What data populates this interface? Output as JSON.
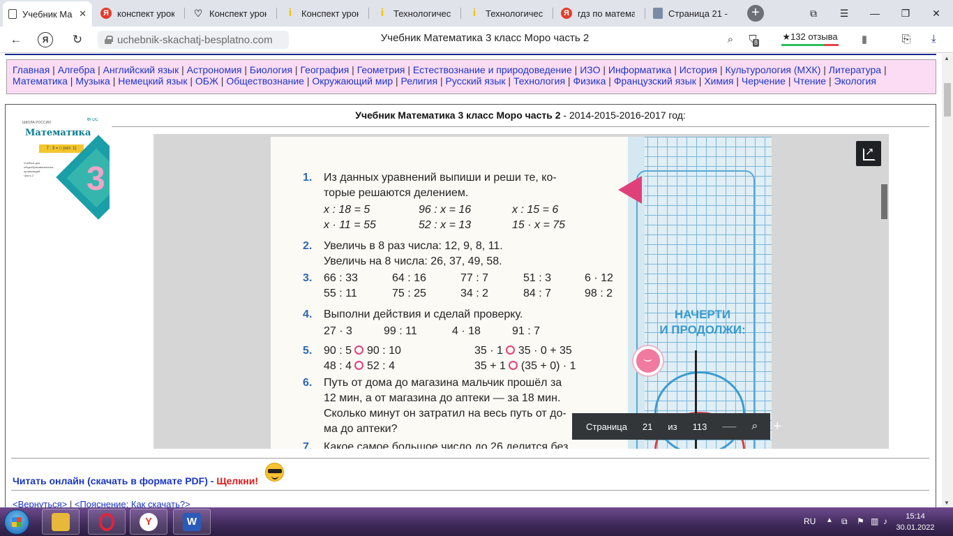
{
  "browser": {
    "tabs": [
      {
        "title": "Учебник Ма",
        "icon": "page-icon",
        "active": true
      },
      {
        "title": "конспект урок",
        "icon": "yandex-icon"
      },
      {
        "title": "Конспект урок",
        "icon": "heart-icon"
      },
      {
        "title": "Конспект урок",
        "icon": "yellow-i-icon"
      },
      {
        "title": "Технологическ",
        "icon": "yellow-i-icon"
      },
      {
        "title": "Технологическ",
        "icon": "yellow-i-icon"
      },
      {
        "title": "гдз по математ",
        "icon": "yandex-icon"
      },
      {
        "title": "Страница 21 -",
        "icon": "doc-icon"
      }
    ],
    "url": "uchebnik-skachatj-besplatno.com",
    "page_title": "Учебник Математика 3 класс Моро часть 2",
    "reviews": "★132 отзыва",
    "tab_badge": "8"
  },
  "nav": {
    "subjects": [
      "Главная",
      "Алгебра",
      "Английский язык",
      "Астрономия",
      "Биология",
      "География",
      "Геометрия",
      "Естествознание и природоведение",
      "ИЗО",
      "Информатика",
      "История",
      "Культурология (МХК)",
      "Литература",
      "Математика",
      "Музыка",
      "Немецкий язык",
      "ОБЖ",
      "Обществознание",
      "Окружающий мир",
      "Религия",
      "Русский язык",
      "Технология",
      "Физика",
      "Французский язык",
      "Химия",
      "Черчение",
      "Чтение",
      "Экология"
    ]
  },
  "book": {
    "heading_bold": "Учебник Математика 3 класс Моро часть 2",
    "heading_rest": " - 2014-2015-2016-2017 год:",
    "cover": {
      "top": "ШКОЛА РОССИИ",
      "title": "Математика",
      "number": "3",
      "fgos": "ФГОС",
      "band": "7 : 3 = □ (ост. 1)",
      "subtitle": "Учебник для общеобразовательных организаций",
      "part": "Часть 2"
    }
  },
  "textbook_page": {
    "ex1_num": "1.",
    "ex1_text1": "Из данных уравнений выпиши и реши те, ко-",
    "ex1_text2": "торые решаются делением.",
    "ex1_eq": [
      "x : 18 = 5",
      "96 : x = 16",
      "x : 15 = 6",
      "x · 11 = 55",
      "52 : x = 13",
      "15 · x = 75"
    ],
    "ex2_num": "2.",
    "ex2_line1": "Увеличь в 8 раз числа: 12, 9, 8, 11.",
    "ex2_line2": "Увеличь на 8 числа: 26, 37, 49, 58.",
    "ex3_num": "3.",
    "ex3_row1": [
      "66 : 33",
      "64 : 16",
      "77 : 7",
      "51 : 3",
      "6 · 12"
    ],
    "ex3_row2": [
      "55 : 11",
      "75 : 25",
      "34 : 2",
      "84 : 7",
      "98 : 2"
    ],
    "ex4_num": "4.",
    "ex4_text": "Выполни действия и сделай проверку.",
    "ex4_row": [
      "27 · 3",
      "99 : 11",
      "4 · 18",
      "91 : 7"
    ],
    "ex5_num": "5.",
    "ex5_row1": [
      "90 : 5",
      "90 : 10",
      "35 · 1",
      "35 · 0 + 35"
    ],
    "ex5_row2": [
      "48 : 4",
      "52 : 4",
      "35 + 1",
      "(35 + 0) · 1"
    ],
    "ex6_num": "6.",
    "ex6_l1": "Путь от дома до магазина мальчик прошёл за",
    "ex6_l2": "12 мин, а от магазина до аптеки — за 18 мин.",
    "ex6_l3": "Сколько минут он затратил на весь путь от до-",
    "ex6_l4": "ма до аптеки?",
    "ex7_num": "7.",
    "ex7_l1": "Какое самое большое число до 26 делится без",
    "margin_line1": "НАЧЕРТИ",
    "margin_line2": "И ПРОДОЛЖИ:"
  },
  "viewer": {
    "page_label": "Страница",
    "page_current": "21",
    "page_of": "из",
    "page_total": "113"
  },
  "footer": {
    "read_online": "Читать онлайн (скачать в формате PDF) - ",
    "click": "Щелкни!",
    "back": "<Вернуться>",
    "sep": " | ",
    "explain": "<Пояснение: Как скачать?>"
  },
  "taskbar": {
    "lang": "RU",
    "time": "15:14",
    "date": "30.01.2022",
    "apps": [
      "explorer-icon",
      "opera-icon",
      "yandex-browser-icon",
      "word-icon"
    ]
  },
  "colors": {
    "link": "#1a36c8",
    "nav_bg": "#fcdcf4",
    "accent_pink": "#e0407a",
    "number_blue": "#2a68b8"
  }
}
